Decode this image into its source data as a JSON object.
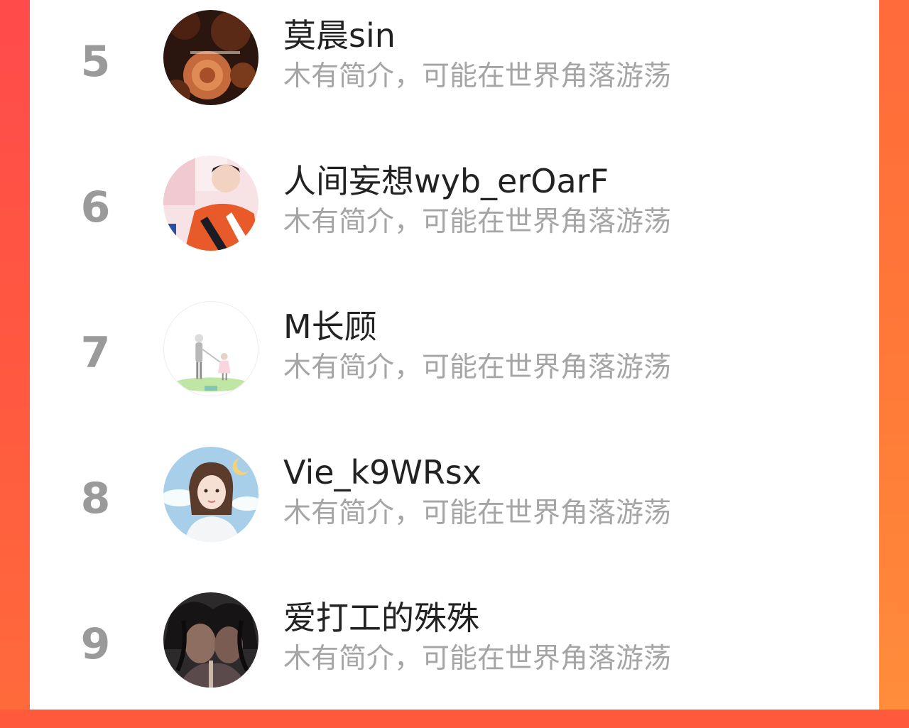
{
  "ranking": {
    "items": [
      {
        "rank": "5",
        "name": "莫晨sin",
        "bio": "木有简介，可能在世界角落游荡",
        "avatar_icon": "rose-avatar-icon"
      },
      {
        "rank": "6",
        "name": "人间妄想wyb_erOarF",
        "bio": "木有简介，可能在世界角落游荡",
        "avatar_icon": "racer-portrait-avatar-icon"
      },
      {
        "rank": "7",
        "name": "M长顾",
        "bio": "木有简介，可能在世界角落游荡",
        "avatar_icon": "father-daughter-illustration-avatar-icon"
      },
      {
        "rank": "8",
        "name": "Vie_k9WRsx",
        "bio": "木有简介，可能在世界角落游荡",
        "avatar_icon": "girl-illustration-avatar-icon"
      },
      {
        "rank": "9",
        "name": "爱打工的殊殊",
        "bio": "木有简介，可能在世界角落游荡",
        "avatar_icon": "dark-art-avatar-icon"
      }
    ]
  },
  "colors": {
    "background_accent": "#ff5a3c",
    "rank_text": "#9a9a9a",
    "name_text": "#222222",
    "bio_text": "#a5a5a5"
  }
}
